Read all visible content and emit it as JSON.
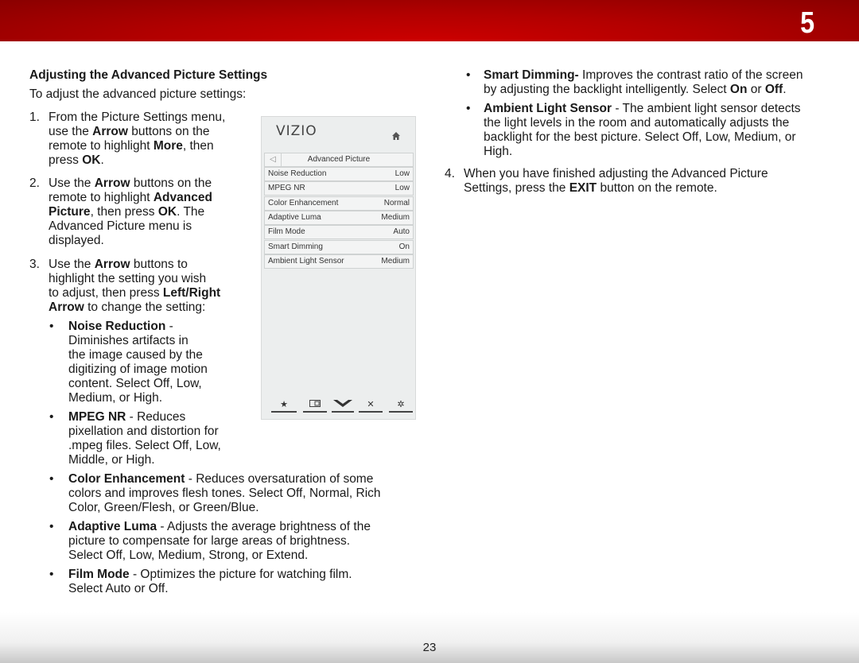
{
  "header": {
    "chapter": "5"
  },
  "footer": {
    "page_number": "23"
  },
  "left": {
    "heading": "Adjusting the Advanced Picture Settings",
    "intro": "To adjust the advanced picture settings:",
    "steps": [
      {
        "num": "1.",
        "lines": [
          "From the Picture Settings menu,",
          "use the |Arrow| buttons on the",
          "remote to highlight |More|, then",
          "press |OK|."
        ]
      },
      {
        "num": "2.",
        "lines": [
          "Use the |Arrow| buttons on the",
          "remote to highlight |Advanced|",
          "|Picture|, then press |OK|. The",
          "Advanced Picture menu is",
          "displayed."
        ]
      },
      {
        "num": "3.",
        "lines": [
          "Use the |Arrow| buttons to",
          "highlight the setting you wish",
          "to adjust, then press |Left/Right|",
          "|Arrow| to change the setting:"
        ]
      }
    ],
    "bullets": [
      {
        "lines": [
          "|Noise Reduction| -",
          "Diminishes artifacts in",
          "the image caused by the",
          "digitizing of image motion",
          "content. Select Off, Low,",
          "Medium, or High."
        ]
      },
      {
        "lines": [
          "|MPEG NR| - Reduces",
          "pixellation and distortion for",
          ".mpeg files. Select Off, Low,",
          "Middle, or High."
        ]
      },
      {
        "lines": [
          "|Color Enhancement| - Reduces oversaturation of some",
          "colors and improves flesh tones. Select Off, Normal, Rich",
          "Color, Green/Flesh, or Green/Blue."
        ]
      },
      {
        "lines": [
          "|Adaptive Luma| - Adjusts the average brightness of the",
          "picture to compensate for large areas of brightness.",
          "Select Off, Low, Medium, Strong, or Extend."
        ]
      },
      {
        "lines": [
          "|Film Mode| - Optimizes the picture for watching film.",
          "Select Auto or Off."
        ]
      }
    ]
  },
  "right": {
    "bullets": [
      {
        "lines": [
          "|Smart Dimming-| Improves the contrast ratio of the screen",
          "by adjusting the backlight intelligently. Select |On| or |Off|."
        ]
      },
      {
        "lines": [
          "|Ambient Light Sensor| - The ambient light sensor detects",
          "the light levels in the room and automatically adjusts the",
          "backlight for the best picture. Select Off, Low, Medium, or",
          "High."
        ]
      }
    ],
    "step4": {
      "num": "4.",
      "lines": [
        "When you have finished adjusting the Advanced Picture",
        "Settings, press the |EXIT| button on the remote."
      ]
    }
  },
  "tv_menu": {
    "logo": "VIZIO",
    "home_icon": "home-icon",
    "back_icon": "back-arrow-icon",
    "title": "Advanced Picture",
    "items": [
      {
        "label": "Noise Reduction",
        "value": "Low"
      },
      {
        "label": "MPEG NR",
        "value": "Low"
      },
      {
        "label": "Color Enhancement",
        "value": "Normal"
      },
      {
        "label": "Adaptive Luma",
        "value": "Medium"
      },
      {
        "label": "Film Mode",
        "value": "Auto"
      },
      {
        "label": "Smart Dimming",
        "value": "On"
      },
      {
        "label": "Ambient Light Sensor",
        "value": "Medium"
      }
    ],
    "bottom_icons": [
      "star-icon",
      "widescreen-icon",
      "vizio-v-icon",
      "close-icon",
      "gear-icon"
    ],
    "bottom_glyphs": [
      "★",
      "",
      "",
      "✕",
      "✲"
    ]
  }
}
